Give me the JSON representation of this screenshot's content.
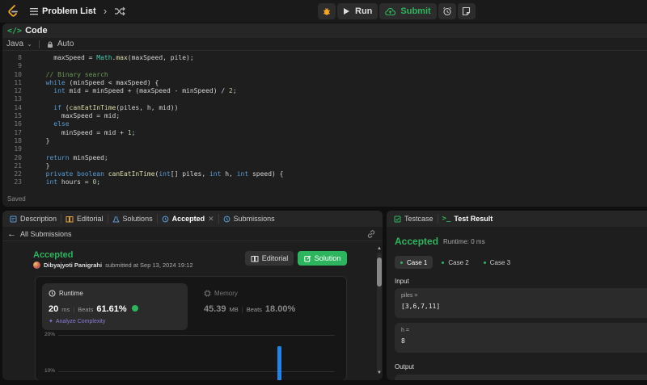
{
  "topbar": {
    "problem_list_label": "Problem List",
    "run_label": "Run",
    "submit_label": "Submit",
    "colors": {
      "accent_green": "#2db55d",
      "logo_orange": "#f5a623"
    }
  },
  "code_panel": {
    "title": "Code",
    "language": "Java",
    "mode": "Auto",
    "saved_text": "Saved",
    "line_numbers": [
      "8",
      "9",
      "10",
      "11",
      "12",
      "13",
      "14",
      "15",
      "16",
      "17",
      "18",
      "19",
      "20",
      "21",
      "22",
      "23"
    ]
  },
  "description_panel": {
    "tabs": [
      "Description",
      "Editorial",
      "Solutions",
      "Accepted",
      "Submissions"
    ],
    "back_label": "All Submissions",
    "status": "Accepted",
    "author": "Dibyajyoti Panigrahi",
    "submitted_text": "submitted at Sep 13, 2024 19:12",
    "editorial_button": "Editorial",
    "solution_button": "Solution",
    "runtime": {
      "label": "Runtime",
      "value": "20",
      "unit": "ms",
      "beats_label": "Beats",
      "beats": "61.61%",
      "analyze_label": "Analyze Complexity"
    },
    "memory": {
      "label": "Memory",
      "value": "45.39",
      "unit": "MB",
      "beats_label": "Beats",
      "beats": "18.00%"
    },
    "chart_ticks": [
      "20%",
      "10%"
    ]
  },
  "test_panel": {
    "tabs": [
      "Testcase",
      "Test Result"
    ],
    "status": "Accepted",
    "runtime_text": "Runtime: 0 ms",
    "cases": [
      "Case 1",
      "Case 2",
      "Case 3"
    ],
    "input_label": "Input",
    "inputs": [
      {
        "name": "piles =",
        "value": "[3,6,7,11]"
      },
      {
        "name": "h =",
        "value": "8"
      }
    ],
    "output_label": "Output"
  }
}
